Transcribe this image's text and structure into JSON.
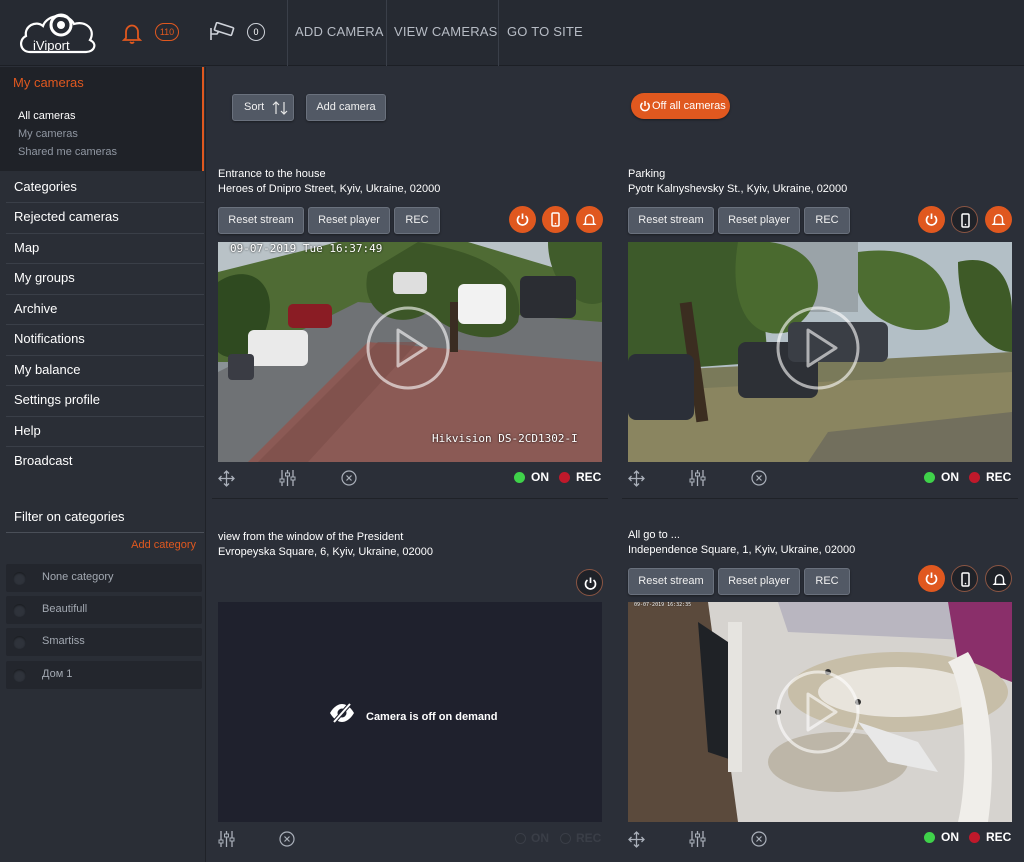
{
  "header": {
    "logo_text": "iViport",
    "notifications_count": "110",
    "cameras_count": "0",
    "nav": [
      "ADD CAMERA",
      "VIEW CAMERAS",
      "GO TO SITE"
    ]
  },
  "sidebar": {
    "section_title": "My cameras",
    "sub_items": [
      "All cameras",
      "My cameras",
      "Shared me cameras"
    ],
    "items": [
      "Categories",
      "Rejected cameras",
      "Map",
      "My groups",
      "Archive",
      "Notifications",
      "My balance",
      "Settings profile",
      "Help",
      "Broadcast"
    ],
    "filter_title": "Filter on categories",
    "add_category": "Add category",
    "categories": [
      "None category",
      "Beautifull",
      "Smartiss",
      "Дом 1"
    ]
  },
  "toolbar": {
    "sort_label": "Sort",
    "add_camera_label": "Add camera",
    "off_all_label": "Off all cameras"
  },
  "cameras": [
    {
      "name": "Entrance to the house",
      "address": "Heroes of Dnipro Street, Kyiv, Ukraine, 02000",
      "reset_stream": "Reset stream",
      "reset_player": "Reset player",
      "rec_button": "REC",
      "osd_time": "09-07-2019 Tue 16:37:49",
      "osd_model": "Hikvision DS-2CD1302-I",
      "on_label": "ON",
      "rec_label": "REC"
    },
    {
      "name": "Parking",
      "address": "Pyotr Kalnyshevsky St., Kyiv, Ukraine, 02000",
      "reset_stream": "Reset stream",
      "reset_player": "Reset player",
      "rec_button": "REC",
      "on_label": "ON",
      "rec_label": "REC"
    },
    {
      "name": "view from the window of the President",
      "address": "Evropeyska Square, 6, Kyiv, Ukraine, 02000",
      "off_message": "Camera is off on demand",
      "on_label": "ON",
      "rec_label": "REC"
    },
    {
      "name": "All go to ...",
      "address": "Independence Square, 1, Kyiv, Ukraine, 02000",
      "reset_stream": "Reset stream",
      "reset_player": "Reset player",
      "rec_button": "REC",
      "osd_time": "09-07-2019 16:32:35",
      "on_label": "ON",
      "rec_label": "REC"
    }
  ],
  "colors": {
    "accent": "#e0581f",
    "status_on": "#3fd24a",
    "status_rec": "#c0192b",
    "status_inactive": "#3a3e47"
  },
  "icons": [
    "bell-icon",
    "cctv-camera-icon",
    "power-icon",
    "phone-icon",
    "move-icon",
    "equalizer-icon",
    "close-circle-icon",
    "play-icon",
    "eye-off-icon",
    "sort-icon"
  ]
}
